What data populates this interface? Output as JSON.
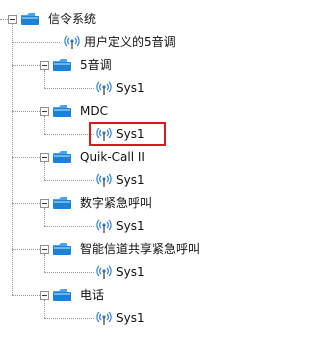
{
  "tree": {
    "root": {
      "label": "信令系统",
      "expanded": true,
      "children": [
        {
          "type": "leaf",
          "label": "用户定义的5音调"
        },
        {
          "type": "folder",
          "label": "5音调",
          "expanded": true,
          "children": [
            {
              "type": "leaf",
              "label": "Sys1",
              "highlighted": false
            }
          ]
        },
        {
          "type": "folder",
          "label": "MDC",
          "expanded": true,
          "children": [
            {
              "type": "leaf",
              "label": "Sys1",
              "highlighted": true
            }
          ]
        },
        {
          "type": "folder",
          "label": "Quik-Call II",
          "expanded": true,
          "children": [
            {
              "type": "leaf",
              "label": "Sys1",
              "highlighted": false
            }
          ]
        },
        {
          "type": "folder",
          "label": "数字紧急呼叫",
          "expanded": true,
          "children": [
            {
              "type": "leaf",
              "label": "Sys1",
              "highlighted": false
            }
          ]
        },
        {
          "type": "folder",
          "label": "智能信道共享紧急呼叫",
          "expanded": true,
          "children": [
            {
              "type": "leaf",
              "label": "Sys1",
              "highlighted": false
            }
          ]
        },
        {
          "type": "folder",
          "label": "电话",
          "expanded": true,
          "children": [
            {
              "type": "leaf",
              "label": "Sys1",
              "highlighted": false
            }
          ]
        }
      ]
    }
  },
  "icons": {
    "folder": "folder-icon",
    "leaf": "antenna-signal-icon",
    "toggle": "collapse-toggle-icon"
  },
  "colors": {
    "folder_body": "#1f7fd0",
    "folder_tab": "#4da3ea",
    "antenna": "#2f7ecf",
    "highlight_border": "#d9191f",
    "connector": "#9a9a9a"
  }
}
